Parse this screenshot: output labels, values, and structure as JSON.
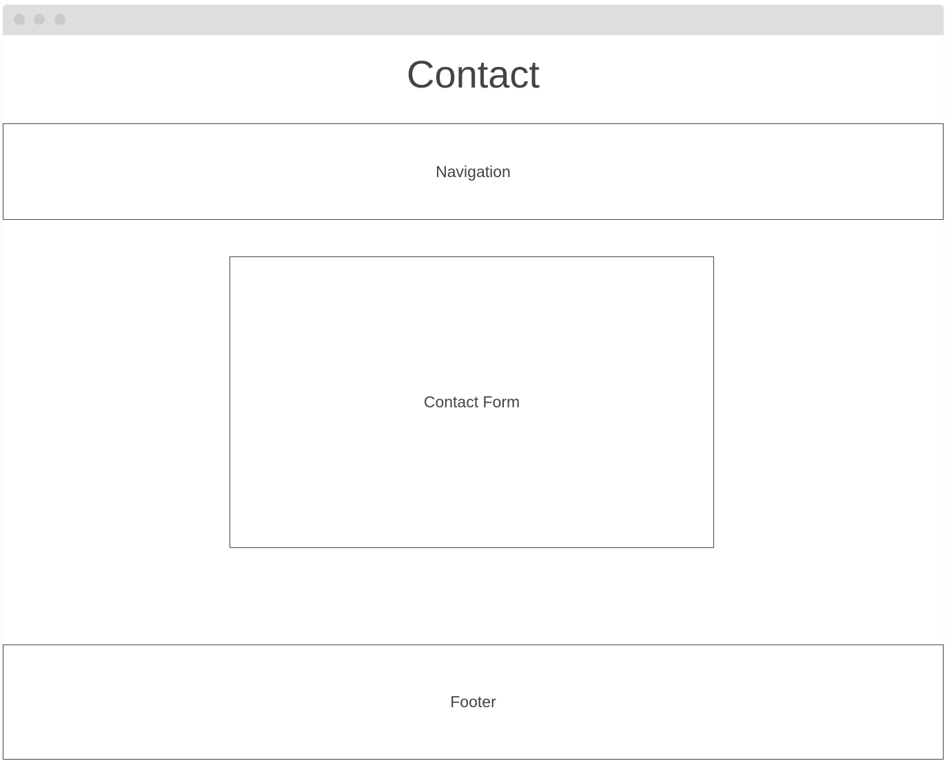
{
  "page": {
    "title": "Contact"
  },
  "sections": {
    "navigation_label": "Navigation",
    "contact_form_label": "Contact Form",
    "footer_label": "Footer"
  },
  "window": {
    "controls": [
      "window-dot",
      "window-dot",
      "window-dot"
    ],
    "titlebar_color": "#dedede",
    "dot_color": "#cacaca"
  },
  "colors": {
    "text": "#444444",
    "border": "#444444",
    "background": "#ffffff"
  }
}
